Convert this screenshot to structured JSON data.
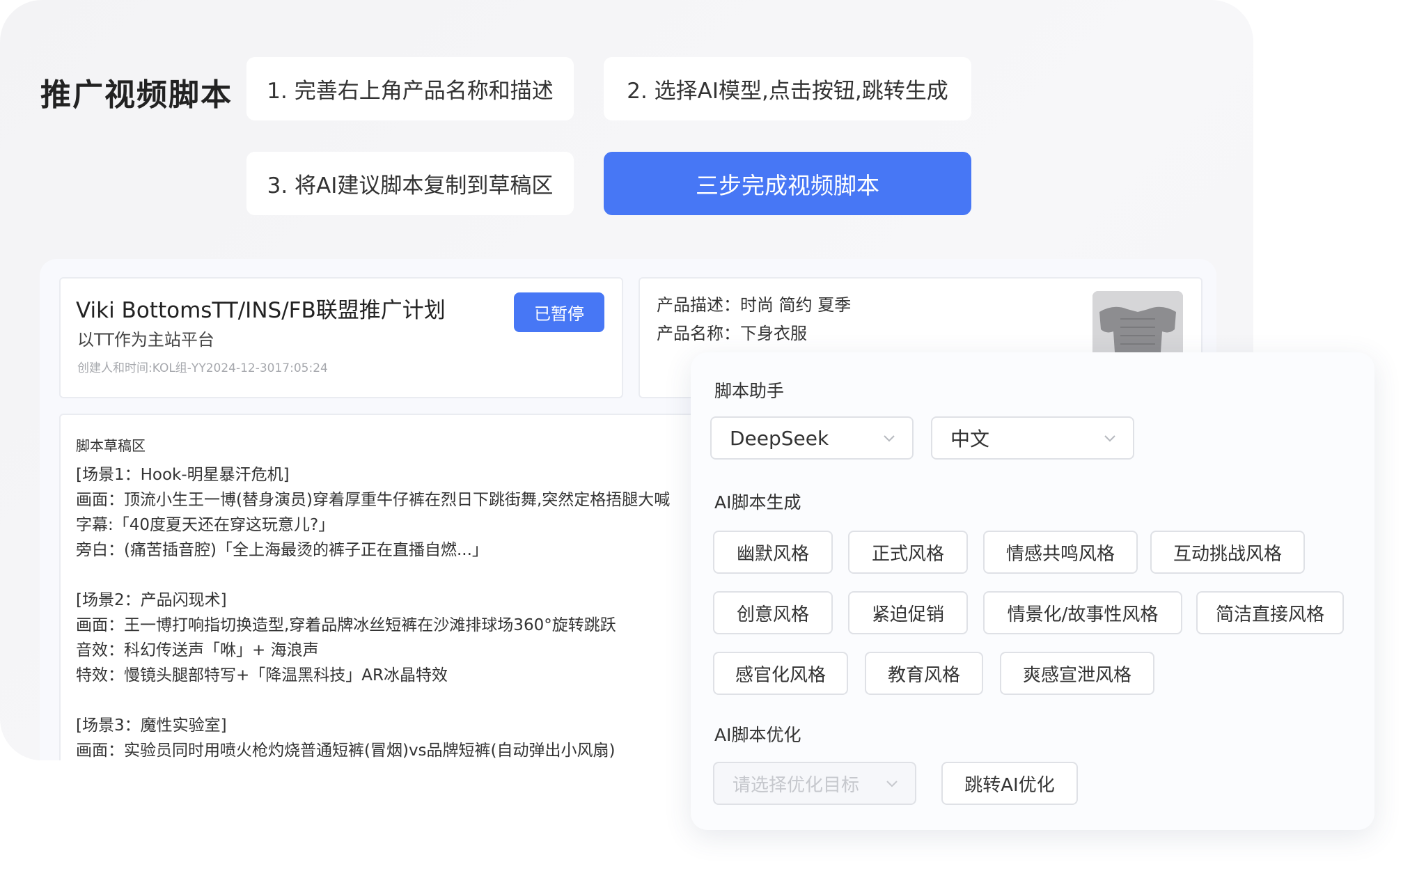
{
  "page": {
    "title": "推广视频脚本"
  },
  "steps": {
    "step1": "1. 完善右上角产品名称和描述",
    "step2": "2. 选择AI模型,点击按钮,跳转生成",
    "step3": "3. 将AI建议脚本复制到草稿区",
    "cta": "三步完成视频脚本"
  },
  "plan": {
    "title": "Viki BottomsTT/INS/FB联盟推广计划",
    "subtitle": "以TT作为主站平台",
    "meta": "创建人和时间:KOL组-YY2024-12-3017:05:24",
    "status": "已暂停"
  },
  "product": {
    "description": "产品描述：时尚 简约 夏季",
    "name": "产品名称：下身衣服",
    "thumbnail_icon": "product-thumbnail-image"
  },
  "draft": {
    "label": "脚本草稿区",
    "lines": [
      "[场景1：Hook-明星暴汗危机]",
      "画面：顶流小生王一博(替身演员)穿着厚重牛仔裤在烈日下跳街舞,突然定格捂腿大喊",
      "字幕:「40度夏天还在穿这玩意儿?」",
      "旁白：(痛苦插音腔)「全上海最烫的裤子正在直播自燃...」",
      "",
      "[场景2：产品闪现术]",
      "画面：王一博打响指切换造型,穿着品牌冰丝短裤在沙滩排球场360°旋转跳跃",
      "音效：科幻传送声「咻」+ 海浪声",
      "特效：慢镜头腿部特写+「降温黑科技」AR冰晶特效",
      "",
      "[场景3：魔性实验室]",
      "画面：实验员同时用喷火枪灼烧普通短裤(冒烟)vs品牌短裤(自动弹出小风扇)"
    ]
  },
  "assistant": {
    "title": "脚本助手",
    "model": "DeepSeek",
    "language": "中文",
    "generate_label": "AI脚本生成",
    "styles": [
      "幽默风格",
      "正式风格",
      "情感共鸣风格",
      "互动挑战风格",
      "创意风格",
      "紧迫促销",
      "情景化/故事性风格",
      "简洁直接风格",
      "感官化风格",
      "教育风格",
      "爽感宣泄风格"
    ],
    "optimize_label": "AI脚本优化",
    "optimize_placeholder": "请选择优化目标",
    "optimize_button": "跳转AI优化"
  }
}
